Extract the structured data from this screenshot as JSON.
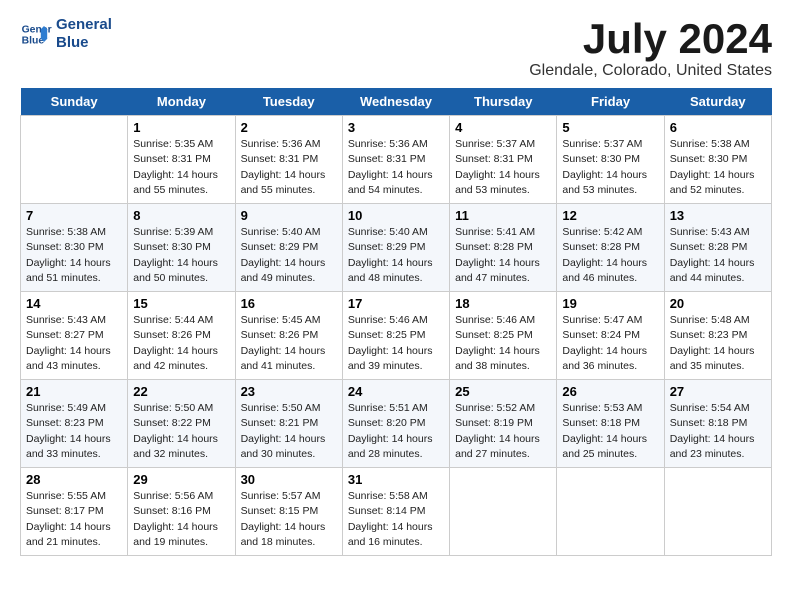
{
  "logo": {
    "line1": "General",
    "line2": "Blue"
  },
  "title": "July 2024",
  "location": "Glendale, Colorado, United States",
  "weekdays": [
    "Sunday",
    "Monday",
    "Tuesday",
    "Wednesday",
    "Thursday",
    "Friday",
    "Saturday"
  ],
  "weeks": [
    [
      {
        "day": "",
        "info": ""
      },
      {
        "day": "1",
        "info": "Sunrise: 5:35 AM\nSunset: 8:31 PM\nDaylight: 14 hours\nand 55 minutes."
      },
      {
        "day": "2",
        "info": "Sunrise: 5:36 AM\nSunset: 8:31 PM\nDaylight: 14 hours\nand 55 minutes."
      },
      {
        "day": "3",
        "info": "Sunrise: 5:36 AM\nSunset: 8:31 PM\nDaylight: 14 hours\nand 54 minutes."
      },
      {
        "day": "4",
        "info": "Sunrise: 5:37 AM\nSunset: 8:31 PM\nDaylight: 14 hours\nand 53 minutes."
      },
      {
        "day": "5",
        "info": "Sunrise: 5:37 AM\nSunset: 8:30 PM\nDaylight: 14 hours\nand 53 minutes."
      },
      {
        "day": "6",
        "info": "Sunrise: 5:38 AM\nSunset: 8:30 PM\nDaylight: 14 hours\nand 52 minutes."
      }
    ],
    [
      {
        "day": "7",
        "info": "Sunrise: 5:38 AM\nSunset: 8:30 PM\nDaylight: 14 hours\nand 51 minutes."
      },
      {
        "day": "8",
        "info": "Sunrise: 5:39 AM\nSunset: 8:30 PM\nDaylight: 14 hours\nand 50 minutes."
      },
      {
        "day": "9",
        "info": "Sunrise: 5:40 AM\nSunset: 8:29 PM\nDaylight: 14 hours\nand 49 minutes."
      },
      {
        "day": "10",
        "info": "Sunrise: 5:40 AM\nSunset: 8:29 PM\nDaylight: 14 hours\nand 48 minutes."
      },
      {
        "day": "11",
        "info": "Sunrise: 5:41 AM\nSunset: 8:28 PM\nDaylight: 14 hours\nand 47 minutes."
      },
      {
        "day": "12",
        "info": "Sunrise: 5:42 AM\nSunset: 8:28 PM\nDaylight: 14 hours\nand 46 minutes."
      },
      {
        "day": "13",
        "info": "Sunrise: 5:43 AM\nSunset: 8:28 PM\nDaylight: 14 hours\nand 44 minutes."
      }
    ],
    [
      {
        "day": "14",
        "info": "Sunrise: 5:43 AM\nSunset: 8:27 PM\nDaylight: 14 hours\nand 43 minutes."
      },
      {
        "day": "15",
        "info": "Sunrise: 5:44 AM\nSunset: 8:26 PM\nDaylight: 14 hours\nand 42 minutes."
      },
      {
        "day": "16",
        "info": "Sunrise: 5:45 AM\nSunset: 8:26 PM\nDaylight: 14 hours\nand 41 minutes."
      },
      {
        "day": "17",
        "info": "Sunrise: 5:46 AM\nSunset: 8:25 PM\nDaylight: 14 hours\nand 39 minutes."
      },
      {
        "day": "18",
        "info": "Sunrise: 5:46 AM\nSunset: 8:25 PM\nDaylight: 14 hours\nand 38 minutes."
      },
      {
        "day": "19",
        "info": "Sunrise: 5:47 AM\nSunset: 8:24 PM\nDaylight: 14 hours\nand 36 minutes."
      },
      {
        "day": "20",
        "info": "Sunrise: 5:48 AM\nSunset: 8:23 PM\nDaylight: 14 hours\nand 35 minutes."
      }
    ],
    [
      {
        "day": "21",
        "info": "Sunrise: 5:49 AM\nSunset: 8:23 PM\nDaylight: 14 hours\nand 33 minutes."
      },
      {
        "day": "22",
        "info": "Sunrise: 5:50 AM\nSunset: 8:22 PM\nDaylight: 14 hours\nand 32 minutes."
      },
      {
        "day": "23",
        "info": "Sunrise: 5:50 AM\nSunset: 8:21 PM\nDaylight: 14 hours\nand 30 minutes."
      },
      {
        "day": "24",
        "info": "Sunrise: 5:51 AM\nSunset: 8:20 PM\nDaylight: 14 hours\nand 28 minutes."
      },
      {
        "day": "25",
        "info": "Sunrise: 5:52 AM\nSunset: 8:19 PM\nDaylight: 14 hours\nand 27 minutes."
      },
      {
        "day": "26",
        "info": "Sunrise: 5:53 AM\nSunset: 8:18 PM\nDaylight: 14 hours\nand 25 minutes."
      },
      {
        "day": "27",
        "info": "Sunrise: 5:54 AM\nSunset: 8:18 PM\nDaylight: 14 hours\nand 23 minutes."
      }
    ],
    [
      {
        "day": "28",
        "info": "Sunrise: 5:55 AM\nSunset: 8:17 PM\nDaylight: 14 hours\nand 21 minutes."
      },
      {
        "day": "29",
        "info": "Sunrise: 5:56 AM\nSunset: 8:16 PM\nDaylight: 14 hours\nand 19 minutes."
      },
      {
        "day": "30",
        "info": "Sunrise: 5:57 AM\nSunset: 8:15 PM\nDaylight: 14 hours\nand 18 minutes."
      },
      {
        "day": "31",
        "info": "Sunrise: 5:58 AM\nSunset: 8:14 PM\nDaylight: 14 hours\nand 16 minutes."
      },
      {
        "day": "",
        "info": ""
      },
      {
        "day": "",
        "info": ""
      },
      {
        "day": "",
        "info": ""
      }
    ]
  ]
}
